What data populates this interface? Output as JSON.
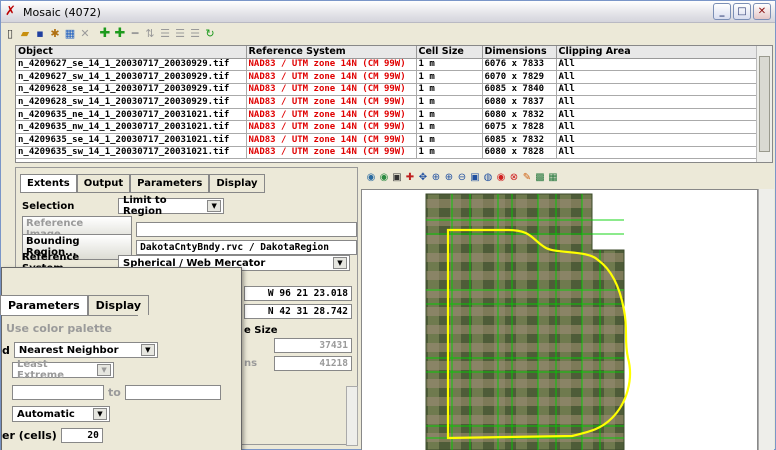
{
  "window": {
    "title": "Mosaic (4072)"
  },
  "table": {
    "headers": [
      "Object",
      "Reference System",
      "Cell Size",
      "Dimensions",
      "Clipping Area"
    ],
    "rows": [
      [
        "n_4209627_se_14_1_20030717_20030929.tif",
        "NAD83 / UTM zone 14N (CM 99W)",
        "1 m",
        "6076 x 7833",
        "All"
      ],
      [
        "n_4209627_sw_14_1_20030717_20030929.tif",
        "NAD83 / UTM zone 14N (CM 99W)",
        "1 m",
        "6070 x 7829",
        "All"
      ],
      [
        "n_4209628_se_14_1_20030717_20030929.tif",
        "NAD83 / UTM zone 14N (CM 99W)",
        "1 m",
        "6085 x 7840",
        "All"
      ],
      [
        "n_4209628_sw_14_1_20030717_20030929.tif",
        "NAD83 / UTM zone 14N (CM 99W)",
        "1 m",
        "6080 x 7837",
        "All"
      ],
      [
        "n_4209635_ne_14_1_20030717_20031021.tif",
        "NAD83 / UTM zone 14N (CM 99W)",
        "1 m",
        "6080 x 7832",
        "All"
      ],
      [
        "n_4209635_nw_14_1_20030717_20031021.tif",
        "NAD83 / UTM zone 14N (CM 99W)",
        "1 m",
        "6075 x 7828",
        "All"
      ],
      [
        "n_4209635_se_14_1_20030717_20031021.tif",
        "NAD83 / UTM zone 14N (CM 99W)",
        "1 m",
        "6085 x 7832",
        "All"
      ],
      [
        "n_4209635_sw_14_1_20030717_20031021.tif",
        "NAD83 / UTM zone 14N (CM 99W)",
        "1 m",
        "6080 x 7828",
        "All"
      ]
    ]
  },
  "panel": {
    "tabs": [
      "Extents",
      "Output",
      "Parameters",
      "Display"
    ],
    "selection_label": "Selection",
    "selection_value": "Limit to Region",
    "reference_image_button": "Reference Image...",
    "bounding_region_button": "Bounding Region...",
    "bounding_region_value": "DakotaCntyBndy.rvc / DakotaRegion",
    "reference_system_label": "Reference System",
    "reference_system_value": "Spherical / Web Mercator",
    "lon_value": "W 96 21 23.018",
    "lat_value": "N 42 31 28.742",
    "image_size_label": "e Size",
    "columns_value": "37431",
    "rows_label": "ns",
    "rows_value": "41218"
  },
  "overlay": {
    "tabs": [
      "Parameters",
      "Display"
    ],
    "use_color_palette": "Use color palette",
    "resample_label": "d",
    "resample_value": "Nearest Neighbor",
    "least_extreme": "Least Extreme",
    "to_label": "to",
    "automatic_value": "Automatic",
    "cells_label": "er (cells)",
    "cells_value": "20"
  },
  "colors": {
    "reference_text": "#e00000",
    "boundary": "#ffff00",
    "tile_grid": "#00c000"
  }
}
